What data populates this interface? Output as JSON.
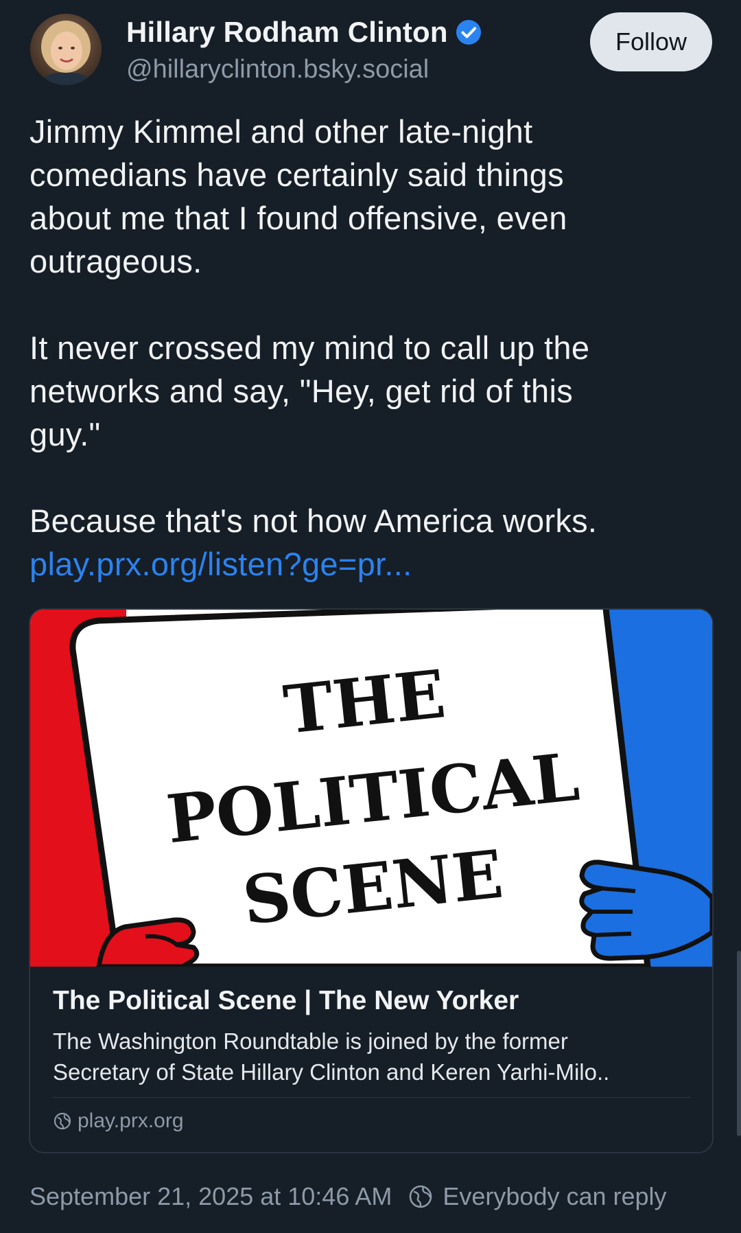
{
  "author": {
    "display_name": "Hillary Rodham Clinton",
    "handle": "@hillaryclinton.bsky.social",
    "verified": true,
    "verified_color": "#2b83f0"
  },
  "header": {
    "follow_label": "Follow"
  },
  "post": {
    "paragraphs": [
      "Jimmy Kimmel and other late-night\ncomedians have certainly said things\nabout me that I found offensive, even\noutrageous.",
      "It never crossed my mind to call up the\nnetworks and say, \"Hey, get rid of this\nguy.\"",
      "Because that's not how America works."
    ],
    "link_text": "play.prx.org/listen?ge=pr..."
  },
  "embed": {
    "image_words": [
      "THE",
      "POLITICAL",
      "SCENE"
    ],
    "title": "The Political Scene | The New Yorker",
    "description": "The Washington Roundtable is joined by the former\nSecretary of State Hillary Clinton and Keren Yarhi-Milo..",
    "domain": "play.prx.org"
  },
  "footer": {
    "timestamp": "September 21, 2025 at 10:46 AM",
    "reply_setting": "Everybody can reply"
  },
  "colors": {
    "background": "#161e27",
    "text": "#f1f3f5",
    "muted": "#8d9aa8",
    "link": "#2b83f0",
    "follow_bg": "#e1e6ec",
    "art_red": "#e30f1b",
    "art_blue": "#1b6fe0"
  },
  "icons": {
    "verified": "verified-check-icon",
    "globe": "globe-icon",
    "reply_setting": "earth-icon"
  }
}
